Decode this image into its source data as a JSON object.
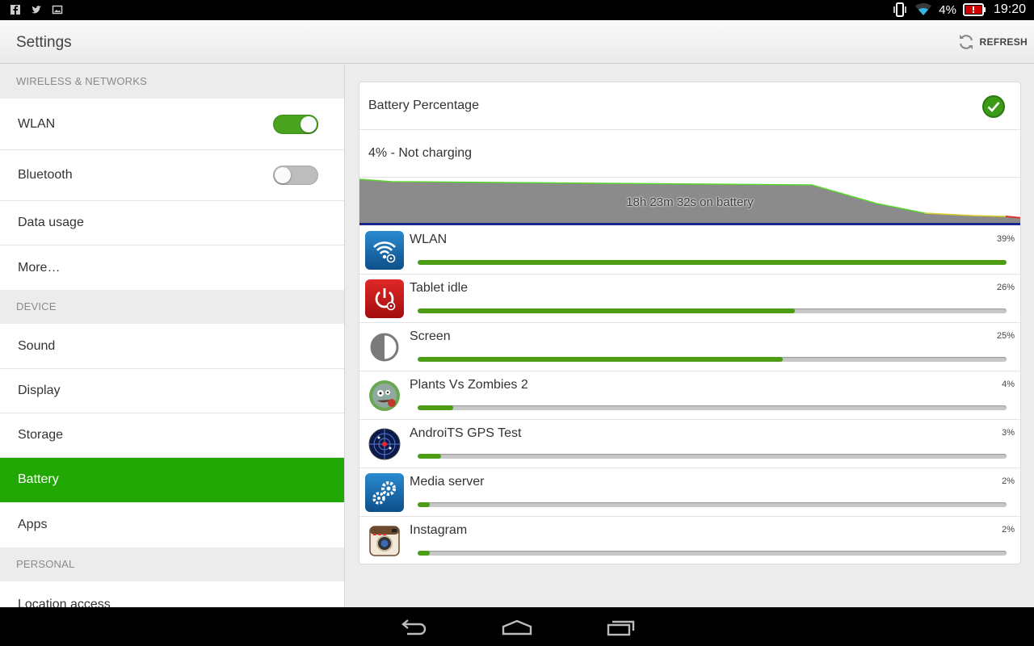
{
  "status_bar": {
    "battery_percent": "4%",
    "time": "19:20",
    "left_icons": [
      "facebook-icon",
      "twitter-icon",
      "gallery-icon"
    ],
    "right_icons": [
      "vibrate-icon",
      "wifi-icon",
      "battery-alert-icon"
    ]
  },
  "action_bar": {
    "title": "Settings",
    "refresh_label": "REFRESH"
  },
  "sidebar": {
    "sections": [
      {
        "header": "WIRELESS & NETWORKS",
        "items": [
          {
            "label": "WLAN",
            "toggle": true
          },
          {
            "label": "Bluetooth",
            "toggle": false
          },
          {
            "label": "Data usage"
          },
          {
            "label": "More…"
          }
        ]
      },
      {
        "header": "DEVICE",
        "items": [
          {
            "label": "Sound"
          },
          {
            "label": "Display"
          },
          {
            "label": "Storage"
          },
          {
            "label": "Battery",
            "active": true
          },
          {
            "label": "Apps"
          }
        ]
      },
      {
        "header": "PERSONAL",
        "items": [
          {
            "label": "Location access"
          }
        ]
      }
    ]
  },
  "battery": {
    "percentage_label": "Battery Percentage",
    "percentage_checked": true,
    "status": "4% - Not charging",
    "graph_label": "18h 23m 32s on battery",
    "apps": [
      {
        "name": "WLAN",
        "percent_label": "39%",
        "fraction": 1.0,
        "icon": "wlan-icon"
      },
      {
        "name": "Tablet idle",
        "percent_label": "26%",
        "fraction": 0.64,
        "icon": "power-icon"
      },
      {
        "name": "Screen",
        "percent_label": "25%",
        "fraction": 0.62,
        "icon": "screen-brightness-icon"
      },
      {
        "name": "Plants Vs Zombies 2",
        "percent_label": "4%",
        "fraction": 0.06,
        "icon": "plants-vs-zombies-icon"
      },
      {
        "name": "AndroiTS GPS Test",
        "percent_label": "3%",
        "fraction": 0.04,
        "icon": "gps-radar-icon"
      },
      {
        "name": "Media server",
        "percent_label": "2%",
        "fraction": 0.02,
        "icon": "gears-icon"
      },
      {
        "name": "Instagram",
        "percent_label": "2%",
        "fraction": 0.02,
        "icon": "instagram-icon"
      }
    ]
  },
  "colors": {
    "accent": "#22a805",
    "bar_fill": "#4c9c14"
  }
}
